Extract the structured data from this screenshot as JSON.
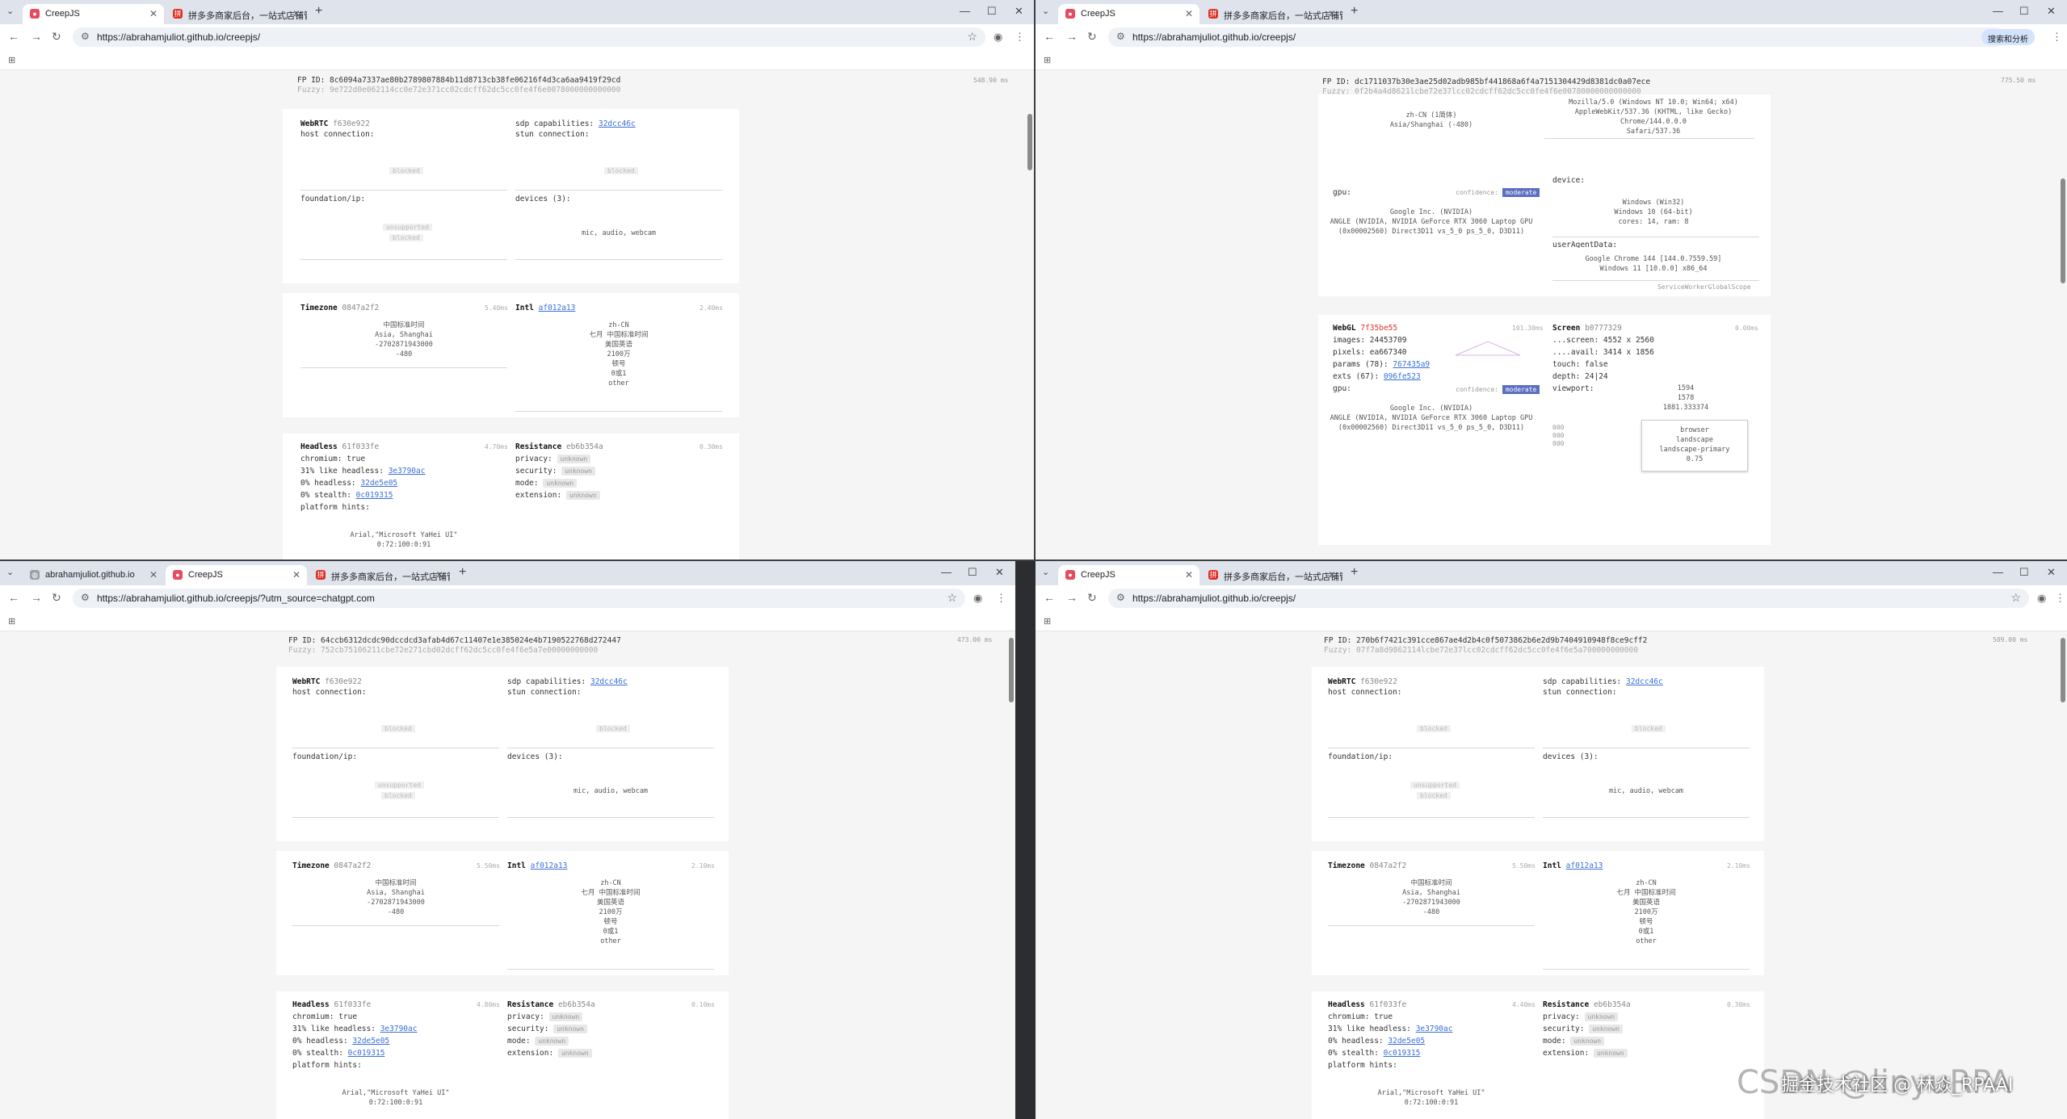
{
  "watermark": "CSDN @linyuRPA",
  "watermark_overlay": "掘金技术社区 @ 林焱_RPAAI",
  "accent_colors": {
    "link": "#3a6fd8",
    "badge": "#5b6ec2",
    "webgl_hash": "#e03030",
    "favicon": "#e02e24"
  },
  "w1": {
    "tabs": [
      {
        "label": "CreepJS"
      },
      {
        "label": "拼多多商家后台，一站式店铺管"
      }
    ],
    "url": "https://abrahamjuliot.github.io/creepjs/",
    "fp_id": "FP ID: 8c6094a7337ae80b2789807884b11d8713cb38fe06216f4d3ca6aa9419f29cd",
    "fuzzy": "Fuzzy: 9e722d0e062114cc0e72e371cc02cdcff62dc5cc0fe4f6e0078000000000000",
    "ms": "548.90 ms",
    "webrtc": {
      "title": "WebRTC",
      "hash": "f630e922",
      "host": "host connection:",
      "sdp": "sdp capabilities:",
      "sdp_hash": "32dcc46c",
      "stun": "stun connection:",
      "blocked": "blocked",
      "foundation": "foundation/ip:",
      "unsupported": "unsupported",
      "devices": "devices (3):",
      "devices_list": "mic, audio, webcam"
    },
    "tz": {
      "title": "Timezone",
      "hash": "0847a2f2",
      "ms": "5.40ms",
      "l1": "中国标准时间",
      "l2": "Asia, Shanghai",
      "l3": "-2702871943000",
      "l4": "-480"
    },
    "intl": {
      "title": "Intl",
      "hash": "af012a13",
      "ms": "2.40ms",
      "l1": "zh-CN",
      "l2": "七月 中国标准时间",
      "l3": "美国英语",
      "l4": "2100万",
      "l5": "顿号",
      "l6": "0或1",
      "l7": "other"
    },
    "headless": {
      "title": "Headless",
      "hash": "61f033fe",
      "ms": "4.70ms",
      "chromium": "chromium: true",
      "like": "31% like headless:",
      "like_hash": "3e3790ac",
      "h0": "0% headless:",
      "h0_hash": "32de5e05",
      "stealth": "0% stealth:",
      "stealth_hash": "0c019315",
      "hints": "platform hints:",
      "fonts": "Arial,\"Microsoft YaHei UI\"",
      "fonts2": "0:72:100:0:91"
    },
    "resist": {
      "title": "Resistance",
      "hash": "eb6b354a",
      "ms": "0.30ms",
      "privacy": "privacy:",
      "security": "security:",
      "mode": "mode:",
      "extension": "extension:",
      "unknown": "unknown"
    }
  },
  "w2": {
    "tabs": [
      {
        "label": "CreepJS"
      },
      {
        "label": "拼多多商家后台，一站式店铺管"
      }
    ],
    "url": "https://abrahamjuliot.github.io/creepjs/",
    "chip": "搜索和分析",
    "fp_id": "FP ID: dc1711037b30e3ae25d02adb985bf441868a6f4a7151304429d8381dc0a07ece",
    "fuzzy": "Fuzzy: 0f2b4a4d8621lcbe72e37lcc02cdcff62dc5cc0fe4f6e00780000000000000",
    "ms": "775.50 ms",
    "lang": "zh-CN (1简体)",
    "tz": "Asia/Shanghai (-480)",
    "ua": [
      "Mozilla/5.0 (Windows NT 10.0; Win64; x64)",
      "AppleWebKit/537.36 (KHTML, like Gecko) Chrome/144.0.0.0",
      "Safari/537.36"
    ],
    "gpu": "gpu:",
    "confidence": "confidence:",
    "moderate": "moderate",
    "gpu_lines": [
      "Google Inc. (NVIDIA)",
      "ANGLE (NVIDIA, NVIDIA GeForce RTX 3060 Laptop GPU",
      "(0x00002560) Direct3D11 vs_5_0 ps_5_0, D3D11)"
    ],
    "device": "device:",
    "device_lines": [
      "Windows (Win32)",
      "Windows 10 (64-bit)",
      "cores: 14, ram: 8"
    ],
    "uad": "userAgentData:",
    "uad_lines": [
      "Google Chrome 144 [144.0.7559.59]",
      "Windows 11 [10.0.0] x86_64"
    ],
    "sw": "ServiceWorkerGlobalScope",
    "webgl": {
      "title": "WebGL",
      "hash": "7f35be55",
      "ms": "101.30ms",
      "images": "images: 24453709",
      "pixels": "pixels: ea667340",
      "params": "params (78):",
      "params_hash": "767435a9",
      "exts": "exts (67):",
      "exts_hash": "096fe523",
      "gpu": "gpu:"
    },
    "screen": {
      "title": "Screen",
      "hash": "b0777329",
      "ms": "0.00ms",
      "screen": "...screen: 4552 x 2560",
      "avail": "....avail: 3414 x 1856",
      "touch": "touch: false",
      "depth": "depth: 24|24",
      "viewport": "viewport:",
      "vp_lines": [
        "1594",
        "1578",
        "1881.333374"
      ],
      "box": [
        "browser",
        "landscape",
        "landscape-primary",
        "0.75"
      ],
      "dims": [
        "000",
        "000",
        "000"
      ]
    }
  },
  "w3": {
    "tabs": [
      {
        "label": "abrahamjuliot.github.io"
      },
      {
        "label": "CreepJS"
      },
      {
        "label": "拼多多商家后台，一站式店铺管"
      }
    ],
    "url": "https://abrahamjuliot.github.io/creepjs/?utm_source=chatgpt.com",
    "fp_id": "FP ID: 64ccb6312dcdc90dccdcd3afab4d67c11407e1e385024e4b7190522768d272447",
    "fuzzy": "Fuzzy: 752cb75106211cbe72e271cbd02dcff62dc5cc0fe4f6e5a7e00000000000",
    "ms": "473.00 ms",
    "webrtc": {
      "title": "WebRTC",
      "hash": "f630e922",
      "host": "host connection:",
      "sdp": "sdp capabilities:",
      "sdp_hash": "32dcc46c",
      "stun": "stun connection:",
      "blocked": "blocked",
      "foundation": "foundation/ip:",
      "unsupported": "unsupported",
      "devices": "devices (3):",
      "devices_list": "mic, audio, webcam"
    },
    "tz": {
      "title": "Timezone",
      "hash": "0847a2f2",
      "ms": "5.50ms",
      "l1": "中国标准时间",
      "l2": "Asia, Shanghai",
      "l3": "-2702871943000",
      "l4": "-480"
    },
    "intl": {
      "title": "Intl",
      "hash": "af012a13",
      "ms": "2.10ms",
      "l1": "zh-CN",
      "l2": "七月 中国标准时间",
      "l3": "美国英语",
      "l4": "2100万",
      "l5": "顿号",
      "l6": "0或1",
      "l7": "other"
    },
    "headless": {
      "title": "Headless",
      "hash": "61f033fe",
      "ms": "4.80ms",
      "chromium": "chromium: true",
      "like": "31% like headless:",
      "like_hash": "3e3790ac",
      "h0": "0% headless:",
      "h0_hash": "32de5e05",
      "stealth": "0% stealth:",
      "stealth_hash": "0c019315",
      "hints": "platform hints:",
      "fonts": "Arial,\"Microsoft YaHei UI\"",
      "fonts2": "0:72:100:0:91"
    },
    "resist": {
      "title": "Resistance",
      "hash": "eb6b354a",
      "ms": "0.10ms",
      "privacy": "privacy:",
      "security": "security:",
      "mode": "mode:",
      "extension": "extension:",
      "unknown": "unknown"
    }
  },
  "w4": {
    "tabs": [
      {
        "label": "CreepJS"
      },
      {
        "label": "拼多多商家后台，一站式店铺管"
      }
    ],
    "url": "https://abrahamjuliot.github.io/creepjs/",
    "fp_id": "FP ID: 270b6f7421c391cce867ae4d2b4c0f5073862b6e2d9b7404910948f8ce9cff2",
    "fuzzy": "Fuzzy: 07f7a8d9862114lcbe72e37lcc02cdcff62dc5cc0fe4f6e5a700000000000",
    "ms": "509.00 ms",
    "webrtc": {
      "title": "WebRTC",
      "hash": "f630e922",
      "host": "host connection:",
      "sdp": "sdp capabilities:",
      "sdp_hash": "32dcc46c",
      "stun": "stun connection:",
      "blocked": "blocked",
      "foundation": "foundation/ip:",
      "unsupported": "unsupported",
      "devices": "devices (3):",
      "devices_list": "mic, audio, webcam"
    },
    "tz": {
      "title": "Timezone",
      "hash": "0847a2f2",
      "ms": "5.50ms",
      "l1": "中国标准时间",
      "l2": "Asia, Shanghai",
      "l3": "-2702871943000",
      "l4": "-480"
    },
    "intl": {
      "title": "Intl",
      "hash": "af012a13",
      "ms": "2.10ms",
      "l1": "zh-CN",
      "l2": "七月 中国标准时间",
      "l3": "美国英语",
      "l4": "2100万",
      "l5": "顿号",
      "l6": "0或1",
      "l7": "other"
    },
    "headless": {
      "title": "Headless",
      "hash": "61f033fe",
      "ms": "4.40ms",
      "chromium": "chromium: true",
      "like": "31% like headless:",
      "like_hash": "3e3790ac",
      "h0": "0% headless:",
      "h0_hash": "32de5e05",
      "stealth": "0% stealth:",
      "stealth_hash": "0c019315",
      "hints": "platform hints:",
      "fonts": "Arial,\"Microsoft YaHei UI\"",
      "fonts2": "0:72:100:0:91"
    },
    "resist": {
      "title": "Resistance",
      "hash": "eb6b354a",
      "ms": "0.30ms",
      "privacy": "privacy:",
      "security": "security:",
      "mode": "mode:",
      "extension": "extension:",
      "unknown": "unknown"
    }
  }
}
